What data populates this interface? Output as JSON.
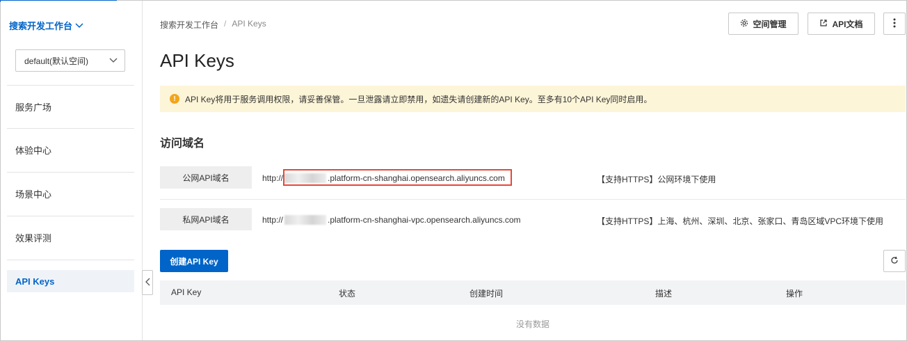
{
  "sidebar": {
    "title": "搜索开发工作台",
    "workspace_select": "default(默认空间)",
    "items": [
      {
        "label": "服务广场"
      },
      {
        "label": "体验中心"
      },
      {
        "label": "场景中心"
      },
      {
        "label": "效果评测"
      },
      {
        "label": "API Keys"
      }
    ]
  },
  "breadcrumb": {
    "root": "搜索开发工作台",
    "separator": "/",
    "current": "API Keys"
  },
  "toolbar": {
    "space_manage": "空间管理",
    "api_docs": "API文档"
  },
  "page": {
    "title": "API Keys"
  },
  "alert": {
    "text": "API Key将用于服务调用权限，请妥善保管。一旦泄露请立即禁用，如遗失请创建新的API Key。至多有10个API Key同时启用。"
  },
  "domains": {
    "title": "访问域名",
    "rows": [
      {
        "label": "公网API域名",
        "prefix": "http://",
        "suffix": ".platform-cn-shanghai.opensearch.aliyuncs.com",
        "note": "【支持HTTPS】公网环境下使用"
      },
      {
        "label": "私网API域名",
        "prefix": "http://",
        "suffix": ".platform-cn-shanghai-vpc.opensearch.aliyuncs.com",
        "note": "【支持HTTPS】上海、杭州、深圳、北京、张家口、青岛区域VPC环境下使用"
      }
    ]
  },
  "actions": {
    "create": "创建API Key"
  },
  "table": {
    "columns": [
      "API Key",
      "状态",
      "创建时间",
      "描述",
      "操作"
    ],
    "empty": "没有数据"
  },
  "colors": {
    "accent": "#0064c8",
    "highlight": "#e5483a",
    "alert_bg": "#fdf5d8"
  }
}
